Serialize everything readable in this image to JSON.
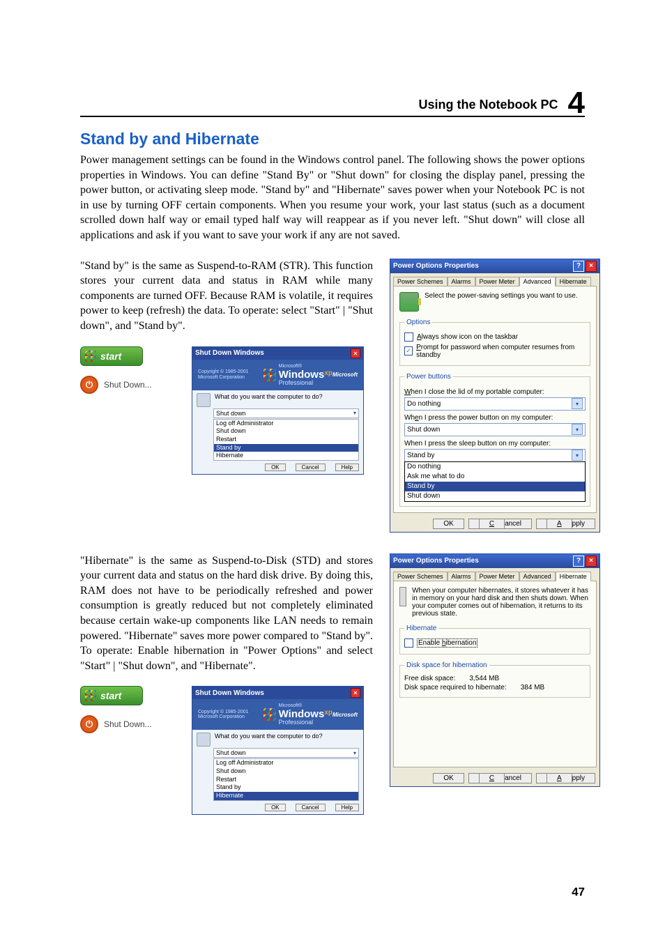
{
  "header": {
    "title": "Using the Notebook PC",
    "chapter": "4"
  },
  "section_heading": "Stand by and Hibernate",
  "intro": "Power management settings can be found in the Windows control panel. The following shows the power options properties in Windows. You can define \"Stand By\" or \"Shut down\" for closing the display panel, pressing the power button, or activating sleep mode. \"Stand by\" and \"Hibernate\" saves power when your Notebook PC is not in use by turning OFF certain components. When you resume your work, your last status (such as a document scrolled down half way or email typed half way will reappear as if you never left. \"Shut down\" will close all applications and ask if you want to save your work if any are not saved.",
  "standby_para": "\"Stand by\" is the same as Suspend-to-RAM (STR). This function stores your current data and status in RAM while many components are turned OFF. Because RAM is volatile, it requires power to keep (refresh) the data. To operate: select \"Start\" | \"Shut down\", and \"Stand by\".",
  "hibernate_para": "\"Hibernate\" is the same as  Suspend-to-Disk (STD) and stores your current data and status on the hard disk drive. By doing this, RAM does not have to be periodically refreshed and power consumption is greatly reduced but not completely eliminated because certain wake-up components like LAN needs to remain powered. \"Hibernate\" saves more power compared to \"Stand by\". To operate: Enable hibernation in \"Power Options\" and select \"Start\" | \"Shut down\", and \"Hibernate\".",
  "start_button": "start",
  "shutdown_menu": "Shut Down...",
  "sd_dialog": {
    "title": "Shut Down Windows",
    "copyright": "Copyright © 1985-2001\nMicrosoft Corporation",
    "brand_small": "Microsoft®",
    "brand_big": "Windows",
    "brand_xp": "xp",
    "brand_edition": "Professional",
    "brand_ms": "Microsoft",
    "question": "What do you want the computer to do?",
    "selected": "Shut down",
    "options": [
      "Log off Administrator",
      "Shut down",
      "Restart",
      "Stand by",
      "Hibernate"
    ],
    "highlight_standby_index": 3,
    "highlight_hibernate_index": 4,
    "btn_ok": "OK",
    "btn_cancel": "Cancel",
    "btn_help": "Help"
  },
  "pop_adv": {
    "title": "Power Options Properties",
    "tabs": [
      "Power Schemes",
      "Alarms",
      "Power Meter",
      "Advanced",
      "Hibernate"
    ],
    "active_tab": "Advanced",
    "desc": "Select the power-saving settings you want to use.",
    "options_legend": "Options",
    "chk_taskbar": "Always show icon on the taskbar",
    "chk_prompt": "Prompt for password when computer resumes from standby",
    "pb_legend": "Power buttons",
    "l_lid": "When I close the lid of my portable computer:",
    "v_lid": "Do nothing",
    "l_power": "When I press the power button on my computer:",
    "v_power": "Shut down",
    "l_sleep": "When I press the sleep button on my computer:",
    "v_sleep": "Stand by",
    "sleep_options": [
      "Do nothing",
      "Ask me what to do",
      "Stand by",
      "Shut down"
    ],
    "btn_ok": "OK",
    "btn_cancel": "Cancel",
    "btn_apply": "Apply"
  },
  "pop_hib": {
    "title": "Power Options Properties",
    "tabs": [
      "Power Schemes",
      "Alarms",
      "Power Meter",
      "Advanced",
      "Hibernate"
    ],
    "active_tab": "Hibernate",
    "desc": "When your computer hibernates, it stores whatever it has in memory on your hard disk and then shuts down. When your computer comes out of hibernation, it returns to its previous state.",
    "hib_legend": "Hibernate",
    "chk_enable": "Enable hibernation",
    "disk_legend": "Disk space for hibernation",
    "free_label": "Free disk space:",
    "free_val": "3,544 MB",
    "req_label": "Disk space required to hibernate:",
    "req_val": "384 MB",
    "btn_ok": "OK",
    "btn_cancel": "Cancel",
    "btn_apply": "Apply"
  },
  "page_number": "47"
}
